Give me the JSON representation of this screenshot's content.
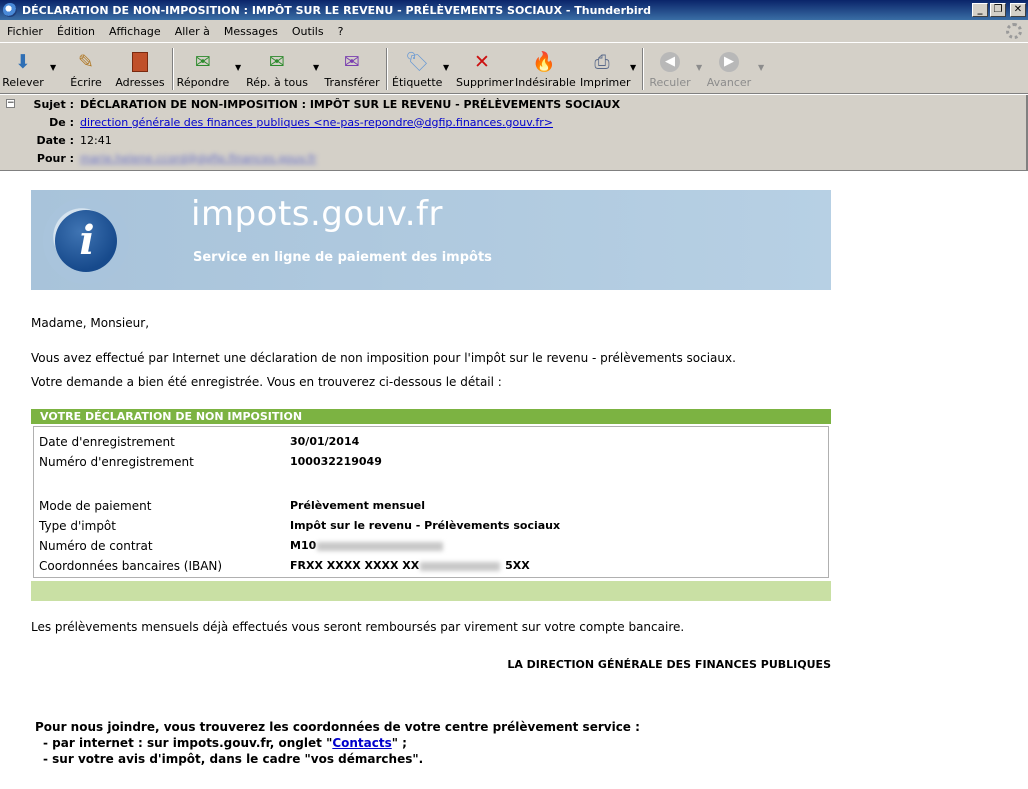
{
  "window": {
    "title": "DÉCLARATION DE NON-IMPOSITION : IMPÔT SUR LE REVENU - PRÉLÈVEMENTS SOCIAUX - Thunderbird",
    "min": "_",
    "max": "❐",
    "close": "✕"
  },
  "menu": [
    "Fichier",
    "Édition",
    "Affichage",
    "Aller à",
    "Messages",
    "Outils",
    "?"
  ],
  "toolbar": {
    "relever": "Relever",
    "ecrire": "Écrire",
    "adresses": "Adresses",
    "repondre": "Répondre",
    "rep_tous": "Rép. à tous",
    "transferer": "Transférer",
    "etiquette": "Étiquette",
    "supprimer": "Supprimer",
    "indesirable": "Indésirable",
    "imprimer": "Imprimer",
    "reculer": "Reculer",
    "avancer": "Avancer"
  },
  "headers": {
    "subject_label": "Sujet :",
    "subject": "DÉCLARATION DE NON-IMPOSITION : IMPÔT SUR LE REVENU - PRÉLÈVEMENTS SOCIAUX",
    "from_label": "De :",
    "from": "direction générale des finances publiques <ne-pas-repondre@dgfip.finances.gouv.fr>",
    "date_label": "Date :",
    "date": "12:41",
    "to_label": "Pour :",
    "to": "marie.helene.ccord@dgfip.finances.gouv.fr"
  },
  "banner": {
    "site": "impots.gouv.fr",
    "tagline": "Service en ligne de paiement des impôts",
    "logo_letter": "i"
  },
  "body": {
    "greeting": "Madame, Monsieur,",
    "line1": "Vous avez effectué par Internet une déclaration de non imposition pour l'impôt sur le revenu - prélèvements sociaux.",
    "line2": "Votre demande a bien été enregistrée. Vous en trouverez ci-dessous le détail :",
    "refund": "Les prélèvements mensuels déjà effectués vous seront remboursés par virement sur votre compte bancaire.",
    "signature": "LA DIRECTION GÉNÉRALE DES FINANCES PUBLIQUES"
  },
  "declaration": {
    "heading": "VOTRE DÉCLARATION DE NON IMPOSITION",
    "date_label": "Date d'enregistrement",
    "date_value": "30/01/2014",
    "num_label": "Numéro d'enregistrement",
    "num_value": "100032219049",
    "mode_label": "Mode de paiement",
    "mode_value": "Prélèvement mensuel",
    "type_label": "Type d'impôt",
    "type_value": "Impôt sur le revenu - Prélèvements sociaux",
    "contrat_label": "Numéro de contrat",
    "contrat_prefix": "M10",
    "iban_label": "Coordonnées bancaires (IBAN)",
    "iban_prefix": "FRXX XXXX XXXX XX",
    "iban_suffix": "5XX"
  },
  "contact": {
    "intro": "Pour nous joindre, vous trouverez les coordonnées de votre centre prélèvement service :",
    "internet_pre": "- par internet : sur impots.gouv.fr, onglet \"",
    "internet_link": "Contacts",
    "internet_post": "\" ;",
    "avis": "- sur votre avis d'impôt, dans le cadre \"vos démarches\"."
  }
}
